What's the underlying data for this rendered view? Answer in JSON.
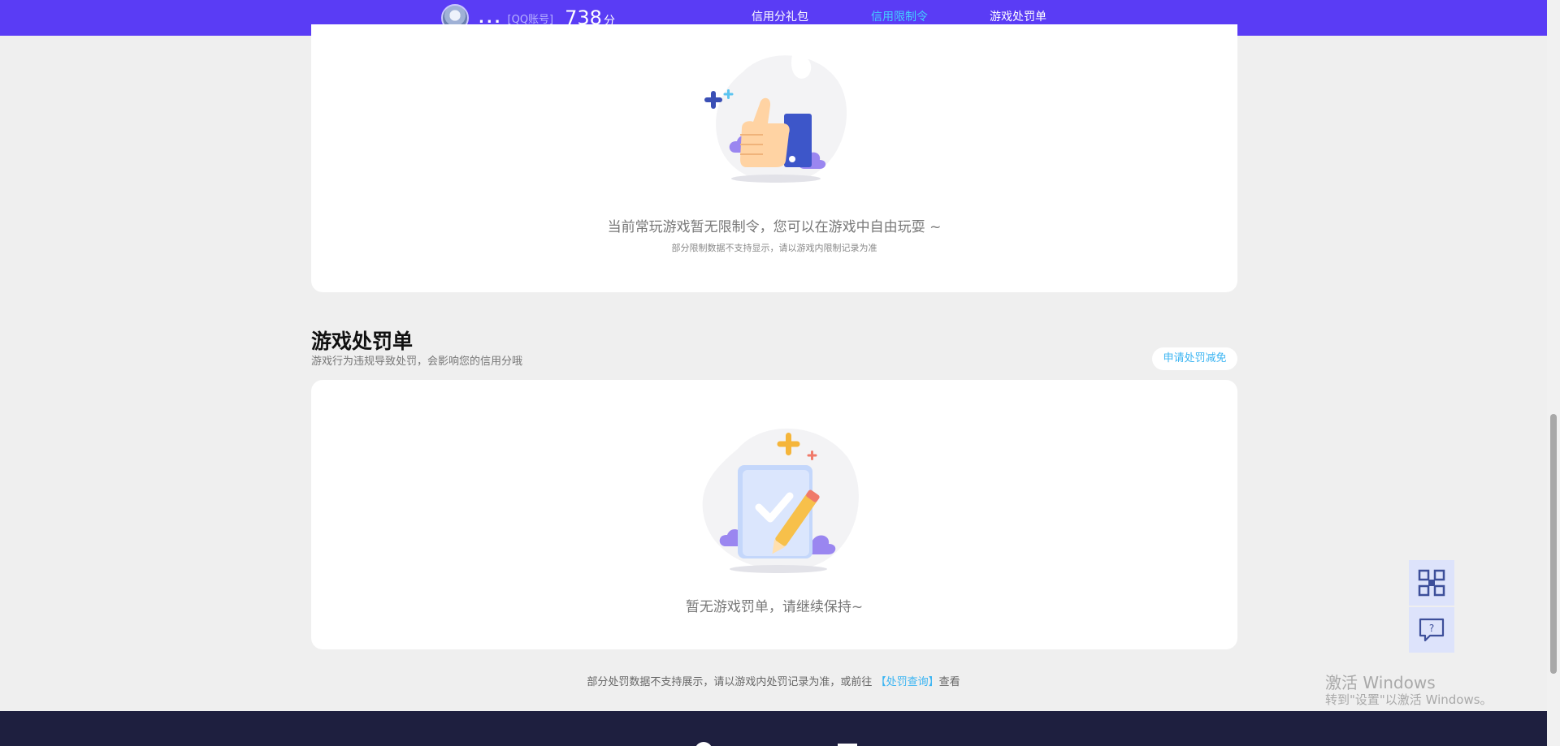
{
  "header": {
    "username": "...",
    "account_type": "[QQ账号]",
    "score": "738",
    "score_unit": "分",
    "tabs": [
      "信用分礼包",
      "信用限制令",
      "游戏处罚单"
    ]
  },
  "restrictions": {
    "empty_message": "当前常玩游戏暂无限制令，您可以在游戏中自由玩耍 ~",
    "note": "部分限制数据不支持显示，请以游戏内限制记录为准"
  },
  "penalties": {
    "title": "游戏处罚单",
    "description": "游戏行为违规导致处罚，会影响您的信用分哦",
    "appeal_button": "申请处罚减免",
    "empty_message": "暂无游戏罚单，请继续保持~"
  },
  "footer_note": {
    "prefix": "部分处罚数据不支持展示，请以游戏内处罚记录为准，或前往",
    "link": "【处罚查询】",
    "suffix": "查看"
  },
  "watermark": {
    "line1": "激活 Windows",
    "line2": "转到\"设置\"以激活 Windows。"
  },
  "colors": {
    "topbar": "#5a3cf5",
    "active_tab": "#43d0ff",
    "link": "#3ab4f2",
    "page_bg": "#efefef"
  },
  "icons": {
    "float_top": "qr-code-icon",
    "float_bottom": "help-chat-icon"
  }
}
